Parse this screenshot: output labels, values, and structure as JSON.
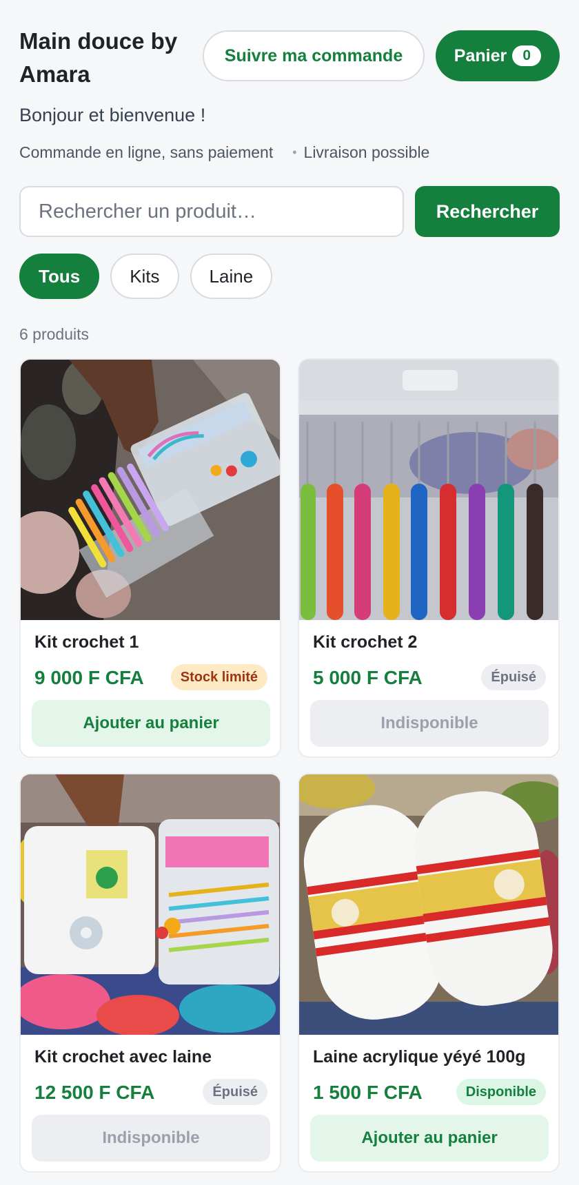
{
  "header": {
    "shop_name": "Main douce by Amara",
    "track_order_label": "Suivre ma commande",
    "cart_label": "Panier",
    "cart_count": "0"
  },
  "intro": {
    "greeting": "Bonjour et bienvenue !",
    "info_1": "Commande en ligne, sans paiement",
    "info_2": "Livraison possible"
  },
  "search": {
    "placeholder": "Rechercher un produit…",
    "button_label": "Rechercher"
  },
  "filters": [
    {
      "label": "Tous",
      "active": true
    },
    {
      "label": "Kits",
      "active": false
    },
    {
      "label": "Laine",
      "active": false
    }
  ],
  "product_count": "6 produits",
  "products": [
    {
      "name": "Kit crochet 1",
      "price": "9 000 F CFA",
      "badge": "Stock limité",
      "status": "limited",
      "button": "Ajouter au panier"
    },
    {
      "name": "Kit crochet 2",
      "price": "5 000 F CFA",
      "badge": "Épuisé",
      "status": "out",
      "button": "Indisponible"
    },
    {
      "name": "Kit crochet avec laine",
      "price": "12 500 F CFA",
      "badge": "Épuisé",
      "status": "out",
      "button": "Indisponible"
    },
    {
      "name": "Laine acrylique yéyé 100g",
      "price": "1 500 F CFA",
      "badge": "Disponible",
      "status": "available",
      "button": "Ajouter au panier"
    }
  ],
  "colors": {
    "brand_green": "#15803d",
    "background": "#f6f7f9",
    "limited_badge": "#fdeac4",
    "available_badge": "#dcf6e6"
  }
}
